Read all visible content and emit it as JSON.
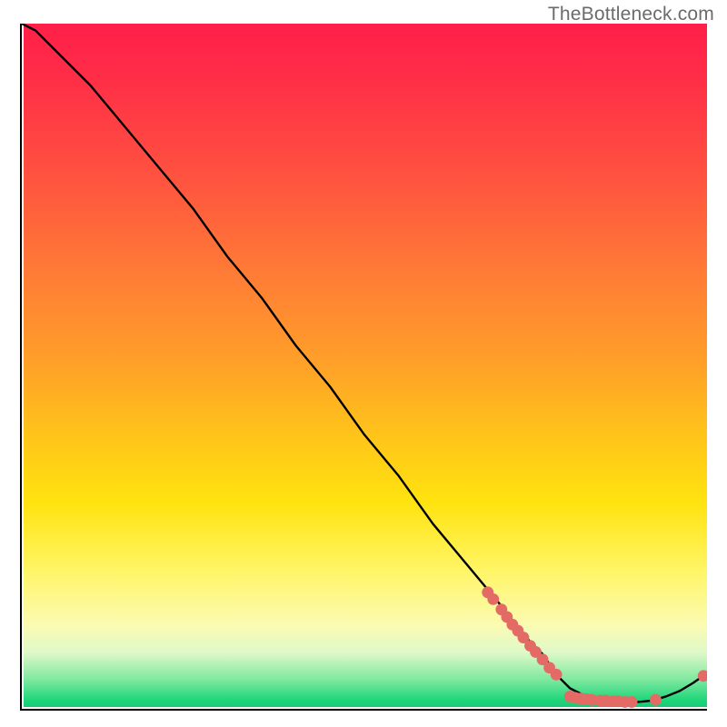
{
  "watermark": "TheBottleneck.com",
  "colors": {
    "gradient_top": "#ff1f49",
    "gradient_mid": "#ffd000",
    "gradient_bottom": "#19c977",
    "curve": "#000000",
    "marker": "#e46a66",
    "axis": "#000000"
  },
  "chart_data": {
    "type": "line",
    "title": "",
    "xlabel": "",
    "ylabel": "",
    "xlim": [
      0,
      100
    ],
    "ylim": [
      0,
      100
    ],
    "grid": false,
    "legend": false,
    "series": [
      {
        "name": "bottleneck-curve",
        "x": [
          0,
          2,
          4,
          7,
          10,
          15,
          20,
          25,
          30,
          35,
          40,
          45,
          50,
          55,
          60,
          65,
          70,
          72,
          74,
          76,
          78,
          80,
          82,
          84,
          86,
          88,
          90,
          92,
          94,
          96,
          98,
          100
        ],
        "y": [
          100,
          99,
          97,
          94,
          91,
          85,
          79,
          73,
          66,
          60,
          53,
          47,
          40,
          34,
          27,
          21,
          15,
          12,
          10,
          8,
          5,
          3,
          2,
          1.2,
          1,
          1,
          1,
          1.2,
          1.8,
          2.6,
          3.8,
          5.2
        ]
      }
    ],
    "markers": [
      {
        "x": 68.0,
        "y": 17.0
      },
      {
        "x": 68.8,
        "y": 16.0
      },
      {
        "x": 70.0,
        "y": 14.5
      },
      {
        "x": 70.8,
        "y": 13.4
      },
      {
        "x": 71.6,
        "y": 12.3
      },
      {
        "x": 72.4,
        "y": 11.4
      },
      {
        "x": 73.2,
        "y": 10.4
      },
      {
        "x": 74.2,
        "y": 9.2
      },
      {
        "x": 75.0,
        "y": 8.3
      },
      {
        "x": 76.0,
        "y": 7.2
      },
      {
        "x": 77.0,
        "y": 6.0
      },
      {
        "x": 78.0,
        "y": 5.0
      },
      {
        "x": 80.0,
        "y": 1.8
      },
      {
        "x": 80.8,
        "y": 1.6
      },
      {
        "x": 81.6,
        "y": 1.5
      },
      {
        "x": 82.4,
        "y": 1.4
      },
      {
        "x": 83.2,
        "y": 1.3
      },
      {
        "x": 84.4,
        "y": 1.2
      },
      {
        "x": 85.2,
        "y": 1.2
      },
      {
        "x": 86.2,
        "y": 1.1
      },
      {
        "x": 87.0,
        "y": 1.1
      },
      {
        "x": 88.0,
        "y": 1.0
      },
      {
        "x": 89.0,
        "y": 1.0
      },
      {
        "x": 92.5,
        "y": 1.3
      },
      {
        "x": 99.5,
        "y": 4.8
      }
    ]
  }
}
